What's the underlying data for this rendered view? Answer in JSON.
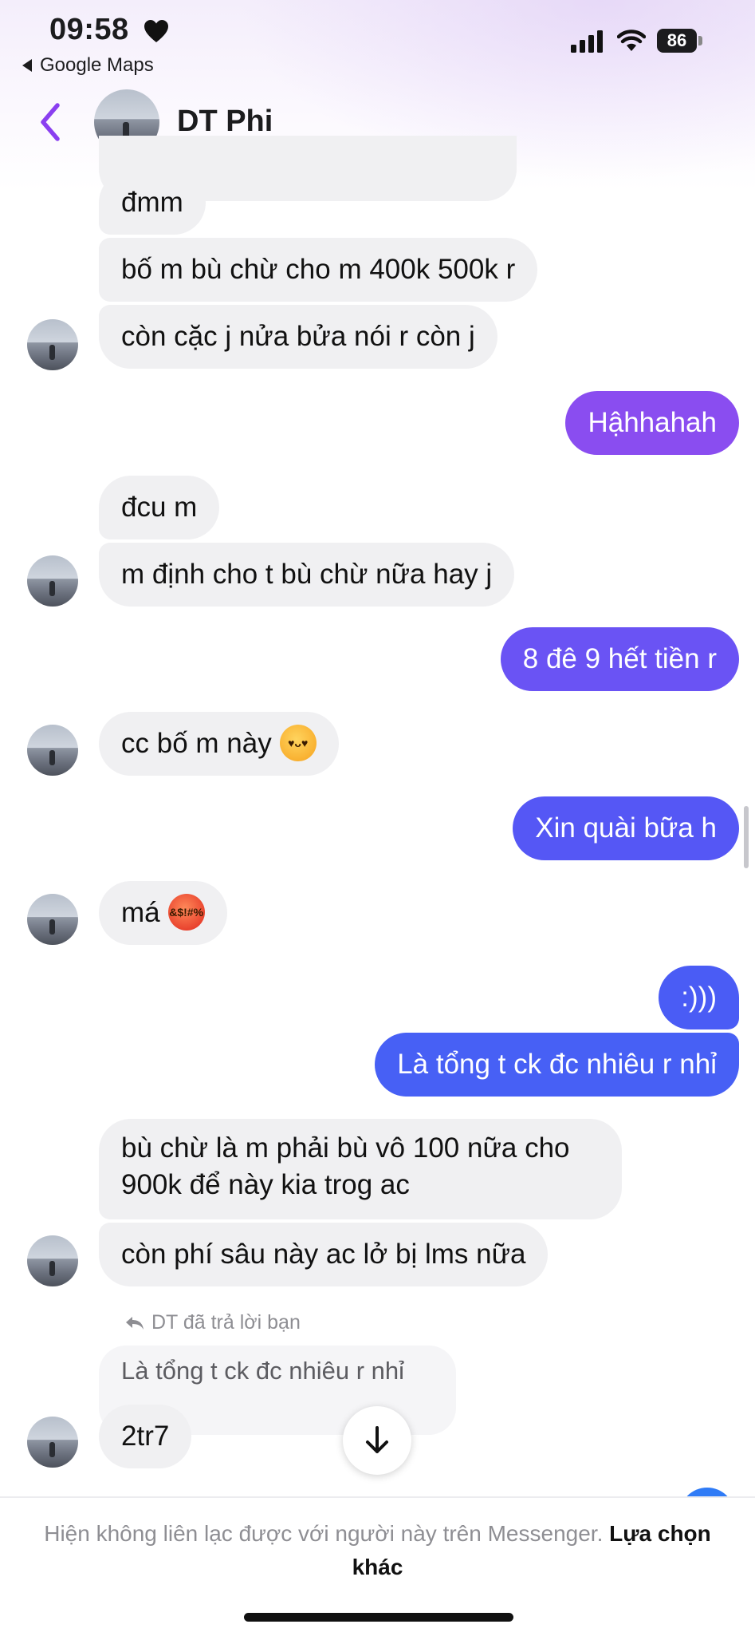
{
  "status_bar": {
    "time": "09:58",
    "back_app": "Google Maps",
    "battery": "86"
  },
  "header": {
    "contact_name": "DT Phi"
  },
  "colors": {
    "accent_purple": "#7b3fe4",
    "outgoing_start": "#8a4df0",
    "outgoing_end": "#3f5ff5",
    "incoming": "#f0f0f2"
  },
  "messages": [
    {
      "direction": "in",
      "text": "đmm"
    },
    {
      "direction": "in",
      "text": "bố m bù chừ cho m 400k 500k r"
    },
    {
      "direction": "in",
      "text": "còn cặc j nửa bửa nói r còn j"
    },
    {
      "direction": "out",
      "text": "Hậhhahah"
    },
    {
      "direction": "in",
      "text": "đcu m"
    },
    {
      "direction": "in",
      "text": "m định cho t bù chừ nữa hay j"
    },
    {
      "direction": "out",
      "text": "8 đê 9 hết tiền r"
    },
    {
      "direction": "in",
      "text": "cc bố m này",
      "emoji": "smiling-face-with-hearts-icon"
    },
    {
      "direction": "out",
      "text": "Xin quài bữa h"
    },
    {
      "direction": "in",
      "text": "má",
      "emoji": "face-with-symbols-icon"
    },
    {
      "direction": "out",
      "text": ":)))"
    },
    {
      "direction": "out",
      "text": "Là tổng t ck đc nhiêu r nhỉ"
    },
    {
      "direction": "in",
      "text": "bù chừ là m phải bù vô 100 nữa cho 900k để này kia trog ac"
    },
    {
      "direction": "in",
      "text": "còn phí sâu này ac lở bị lms nữa"
    },
    {
      "direction": "in",
      "text": "2tr7"
    }
  ],
  "reply": {
    "label": "DT đã trả lời bạn",
    "quoted_text": "Là tổng t ck đc nhiêu r nhỉ"
  },
  "footer": {
    "notice": "Hiện không liên lạc được với người này trên Messenger.",
    "link": "Lựa chọn khác"
  }
}
